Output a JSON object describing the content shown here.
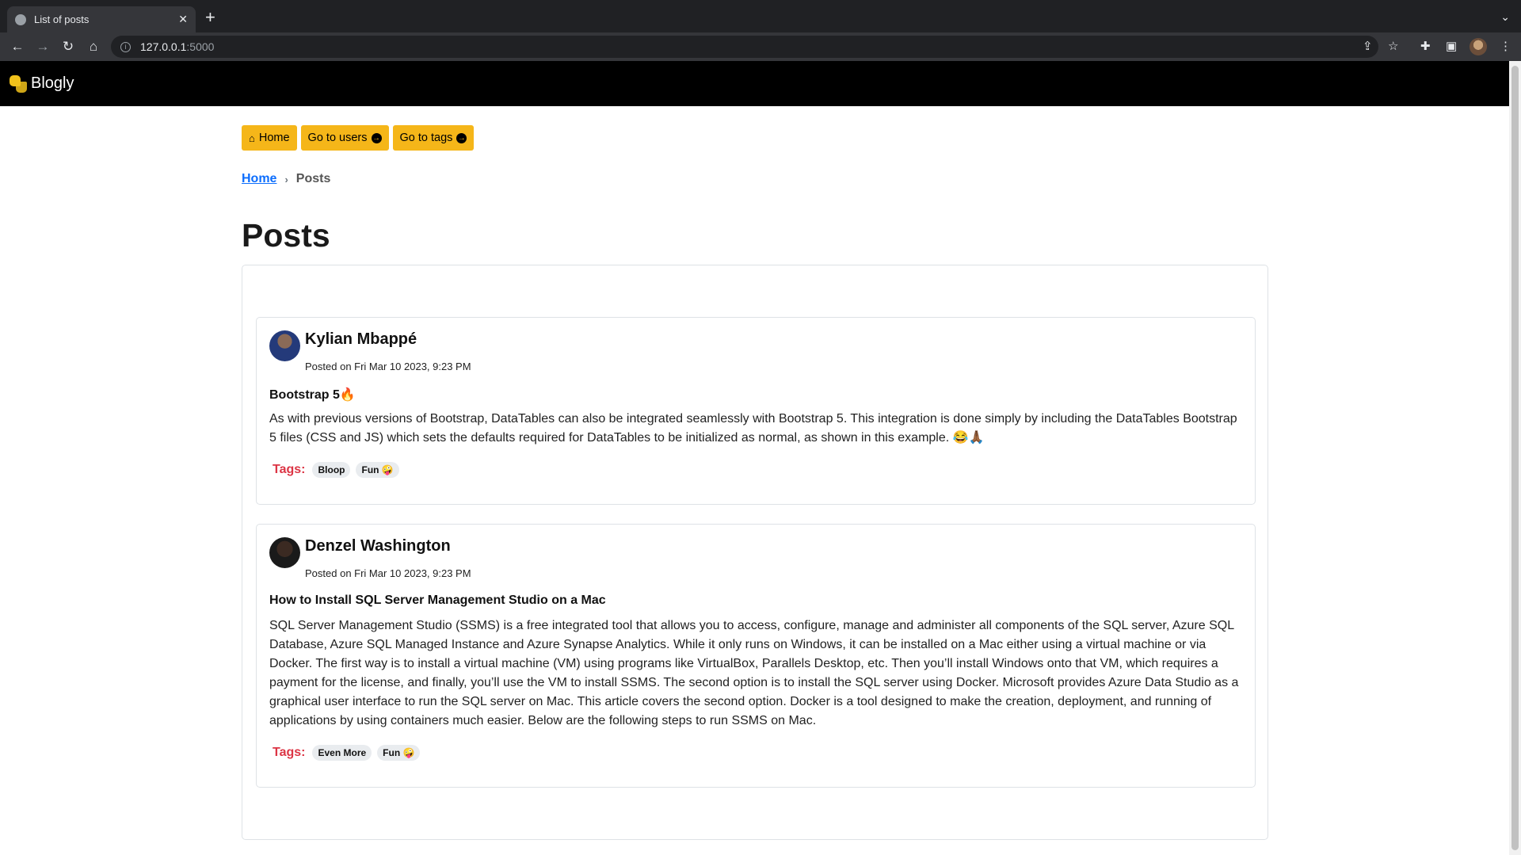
{
  "browser": {
    "tab_title": "List of posts",
    "tab_close": "✕",
    "new_tab": "+",
    "tab_menu": "⌄",
    "url_host": "127.0.0.1",
    "url_port": ":5000",
    "icons": [
      "back-icon",
      "forward-icon",
      "reload-icon",
      "home-icon",
      "share-icon",
      "star-icon",
      "extensions-icon",
      "sidepanel-icon",
      "profile-avatar",
      "menu-icon"
    ]
  },
  "navbar": {
    "brand": "Blogly"
  },
  "buttons": {
    "home": "Home",
    "users": "Go to users",
    "tags": "Go to tags"
  },
  "breadcrumb": {
    "home": "Home",
    "sep": "›",
    "current": "Posts"
  },
  "page_title": "Posts",
  "posts": [
    {
      "author": "Kylian Mbappé",
      "posted": "Posted on Fri Mar 10 2023, 9:23 PM",
      "title": "Bootstrap 5🔥",
      "body": "As with previous versions of Bootstrap, DataTables can also be integrated seamlessly with Bootstrap 5. This integration is done simply by including the DataTables Bootstrap 5 files (CSS and JS) which sets the defaults required for DataTables to be initialized as normal, as shown in this example. 😂🙏🏾",
      "tags_label": "Tags:",
      "tags": [
        "Bloop",
        "Fun 🤪"
      ]
    },
    {
      "author": "Denzel Washington",
      "posted": "Posted on Fri Mar 10 2023, 9:23 PM",
      "title": "How to Install SQL Server Management Studio on a Mac",
      "body": "SQL Server Management Studio (SSMS) is a free integrated tool that allows you to access, configure, manage and administer all components of the SQL server, Azure SQL Database, Azure SQL Managed Instance and Azure Synapse Analytics. While it only runs on Windows, it can be installed on a Mac either using a virtual machine or via Docker. The first way is to install a virtual machine (VM) using programs like VirtualBox, Parallels Desktop, etc. Then you’ll install Windows onto that VM, which requires a payment for the license, and finally, you’ll use the VM to install SSMS. The second option is to install the SQL server using Docker. Microsoft provides Azure Data Studio as a graphical user interface to run the SQL server on Mac. This article covers the second option. Docker is a tool designed to make the creation, deployment, and running of applications by using containers much easier. Below are the following steps to run SSMS on Mac.",
      "tags_label": "Tags:",
      "tags": [
        "Even More",
        "Fun 🤪"
      ]
    }
  ],
  "colors": {
    "button": "#f5b619",
    "navbar": "#000000",
    "tags_label": "#dc3545",
    "link": "#0d6efd"
  }
}
